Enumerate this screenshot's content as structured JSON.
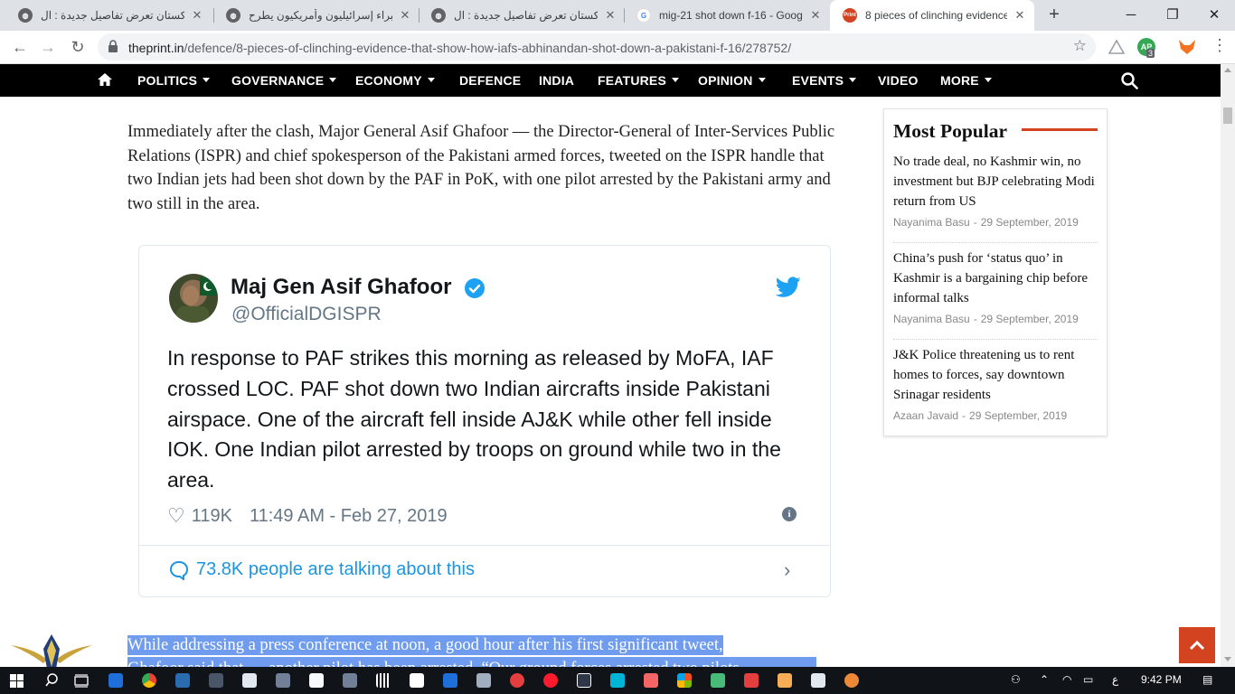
{
  "browser": {
    "tabs": [
      {
        "title": "باكستان تعرض تفاصيل جديدة : ال",
        "favicon": "globe-icon",
        "active": false
      },
      {
        "title": "خبراء إسرائيليون وأمريكيون يطرح",
        "favicon": "globe-icon",
        "active": false
      },
      {
        "title": "باكستان تعرض تفاصيل جديدة : ال",
        "favicon": "globe-icon",
        "active": false
      },
      {
        "title": "mig-21 shot down f-16 - Goog",
        "favicon": "google-icon",
        "active": false
      },
      {
        "title": "8 pieces of clinching evidence",
        "favicon": "theprint-icon",
        "active": true
      }
    ],
    "url_host": "theprint.in",
    "url_path": "/defence/8-pieces-of-clinching-evidence-that-show-how-iafs-abhinandan-shot-down-a-pakistani-f-16/278752/",
    "extension_badge": "3",
    "extension_label": "AP"
  },
  "sitenav": {
    "items": [
      {
        "label": "POLITICS",
        "dropdown": true
      },
      {
        "label": "GOVERNANCE",
        "dropdown": true
      },
      {
        "label": "ECONOMY",
        "dropdown": true
      },
      {
        "label": "DEFENCE",
        "dropdown": false
      },
      {
        "label": "INDIA",
        "dropdown": false
      },
      {
        "label": "FEATURES",
        "dropdown": true
      },
      {
        "label": "OPINION",
        "dropdown": true
      },
      {
        "label": "EVENTS",
        "dropdown": true
      },
      {
        "label": "VIDEO",
        "dropdown": false
      },
      {
        "label": "MORE",
        "dropdown": true
      }
    ]
  },
  "article": {
    "paragraph1": "Immediately after the clash, Major General Asif Ghafoor — the Director-General of Inter-Services Public Relations (ISPR) and chief spokesperson of the Pakistani armed forces, tweeted on the ISPR handle that two Indian jets had been shot down by the PAF in PoK, with one pilot arrested by the Pakistani army and two still in the area.",
    "paragraph2_line1": "While addressing a press conference at noon, a good hour after his first significant tweet,",
    "paragraph2_line2": "Ghafoor said that — another pilot has been arrested. “Our ground forces arrested two pilots"
  },
  "tweet": {
    "name": "Maj Gen Asif Ghafoor",
    "handle": "@OfficialDGISPR",
    "text": "In response to PAF strikes this morning as released by MoFA, IAF crossed LOC. PAF shot down two Indian aircrafts inside Pakistani airspace. One of the aircraft fell inside AJ&K while other fell inside IOK. One Indian pilot arrested by troops on ground while two in the area.",
    "likes": "119K",
    "datetime": "11:49 AM - Feb 27, 2019",
    "talking": "73.8K people are talking about this"
  },
  "popular": {
    "heading": "Most Popular",
    "items": [
      {
        "title": "No trade deal, no Kashmir win, no investment but BJP celebrating Modi return from US",
        "author": "Nayanima Basu",
        "date": "29 September, 2019"
      },
      {
        "title": "China’s push for ‘status quo’ in Kashmir is a bargaining chip before informal talks",
        "author": "Nayanima Basu",
        "date": "29 September, 2019"
      },
      {
        "title": "J&K Police threatening us to rent homes to forces, say downtown Srinagar residents",
        "author": "Azaan Javaid",
        "date": "29 September, 2019"
      }
    ]
  },
  "taskbar": {
    "lang": "ع",
    "time": "9:42 PM"
  },
  "colors": {
    "accent": "#d4431f",
    "twitter_blue": "#1da1f2",
    "selection": "#6f9cef"
  }
}
